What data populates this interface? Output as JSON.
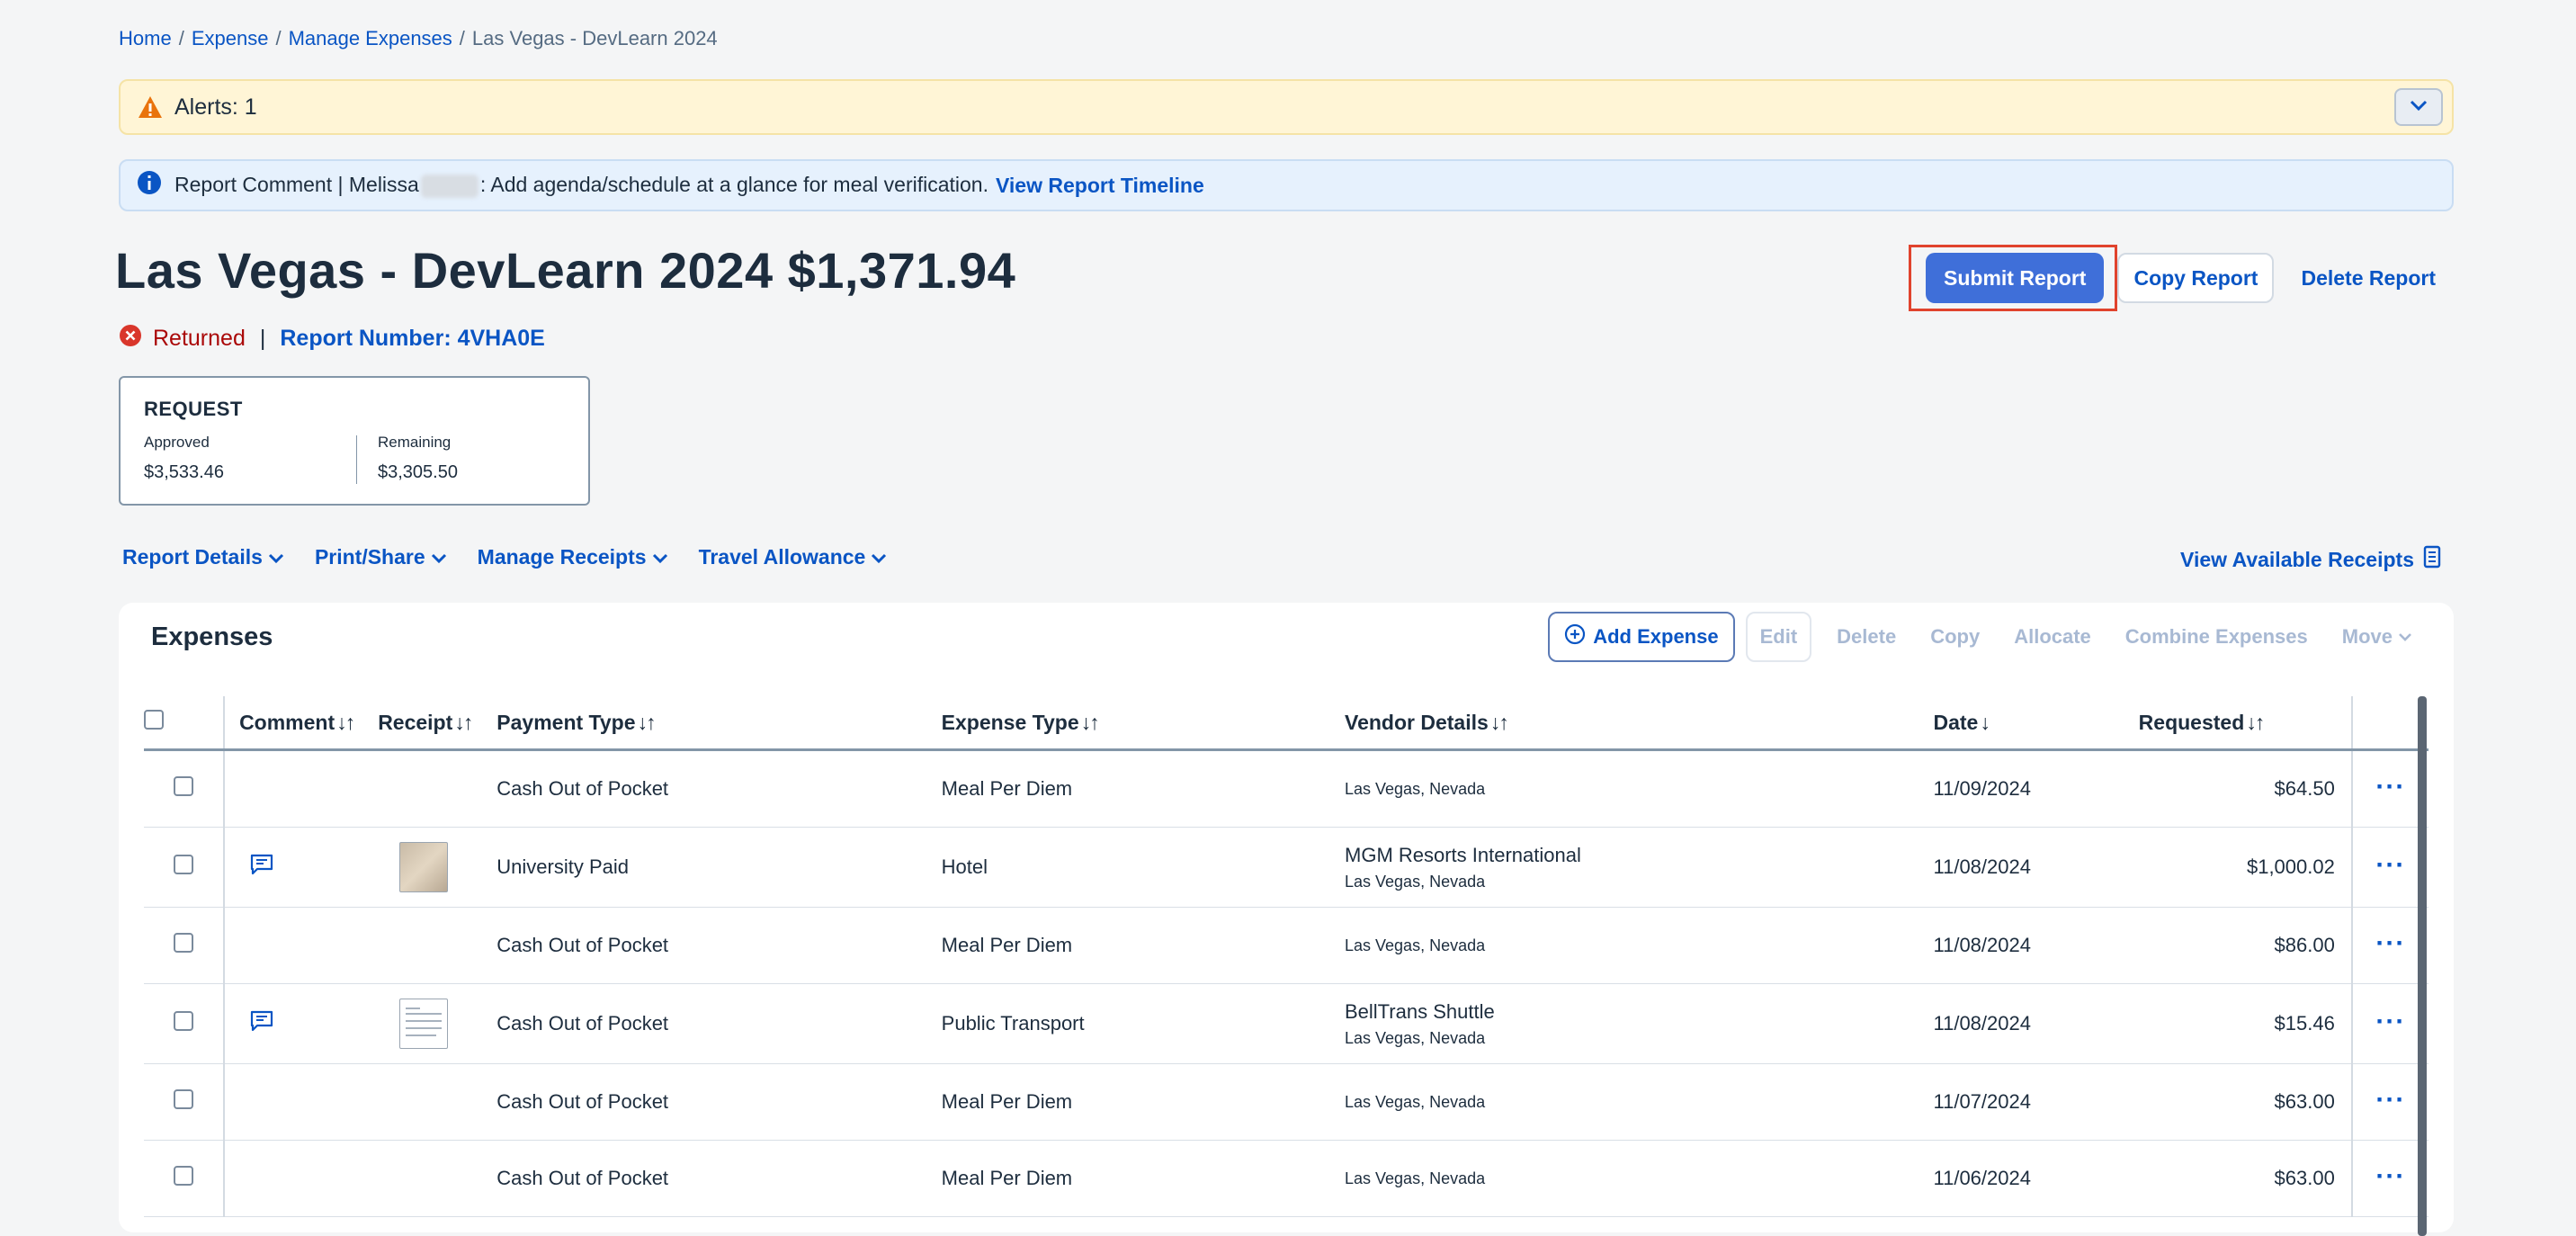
{
  "breadcrumb": {
    "home": "Home",
    "expense": "Expense",
    "manage": "Manage Expenses",
    "current": "Las Vegas - DevLearn 2024",
    "separator": "/"
  },
  "alert": {
    "text": "Alerts: 1"
  },
  "info": {
    "prefix": "Report Comment | Melissa",
    "message": ": Add agenda/schedule at a glance for meal verification.",
    "timeline_link": "View Report Timeline"
  },
  "report": {
    "title": "Las Vegas - DevLearn 2024 $1,371.94",
    "status": "Returned",
    "separator": "|",
    "number_label": "Report Number: 4VHA0E"
  },
  "actions": {
    "submit": "Submit Report",
    "copy": "Copy Report",
    "delete": "Delete Report"
  },
  "request": {
    "title": "REQUEST",
    "approved_label": "Approved",
    "approved_value": "$3,533.46",
    "remaining_label": "Remaining",
    "remaining_value": "$3,305.50"
  },
  "menu": {
    "items": [
      "Report Details",
      "Print/Share",
      "Manage Receipts",
      "Travel Allowance"
    ],
    "view_receipts": "View Available Receipts"
  },
  "expenses": {
    "title": "Expenses",
    "toolbar": {
      "add": "Add Expense",
      "edit": "Edit",
      "delete": "Delete",
      "copy": "Copy",
      "allocate": "Allocate",
      "combine": "Combine Expenses",
      "move": "Move"
    },
    "columns": {
      "comment": "Comment",
      "receipt": "Receipt",
      "payment": "Payment Type",
      "type": "Expense Type",
      "vendor": "Vendor Details",
      "date": "Date",
      "requested": "Requested"
    },
    "rows": [
      {
        "payment": "Cash Out of Pocket",
        "type": "Meal Per Diem",
        "vendor_name": "",
        "vendor_loc": "Las Vegas, Nevada",
        "date": "11/09/2024",
        "amount": "$64.50"
      },
      {
        "payment": "University Paid",
        "type": "Hotel",
        "vendor_name": "MGM Resorts International",
        "vendor_loc": "Las Vegas, Nevada",
        "date": "11/08/2024",
        "amount": "$1,000.02"
      },
      {
        "payment": "Cash Out of Pocket",
        "type": "Meal Per Diem",
        "vendor_name": "",
        "vendor_loc": "Las Vegas, Nevada",
        "date": "11/08/2024",
        "amount": "$86.00"
      },
      {
        "payment": "Cash Out of Pocket",
        "type": "Public Transport",
        "vendor_name": "BellTrans Shuttle",
        "vendor_loc": "Las Vegas, Nevada",
        "date": "11/08/2024",
        "amount": "$15.46"
      },
      {
        "payment": "Cash Out of Pocket",
        "type": "Meal Per Diem",
        "vendor_name": "",
        "vendor_loc": "Las Vegas, Nevada",
        "date": "11/07/2024",
        "amount": "$63.00"
      },
      {
        "payment": "Cash Out of Pocket",
        "type": "Meal Per Diem",
        "vendor_name": "",
        "vendor_loc": "Las Vegas, Nevada",
        "date": "11/06/2024",
        "amount": "$63.00"
      }
    ]
  },
  "colors": {
    "link": "#0a55c4",
    "primary_button": "#3f6fd9",
    "highlight_border": "#e0432d",
    "status_error": "#aa0808",
    "alert_bg": "#fff5d6",
    "info_bg": "#e6f1fd"
  }
}
